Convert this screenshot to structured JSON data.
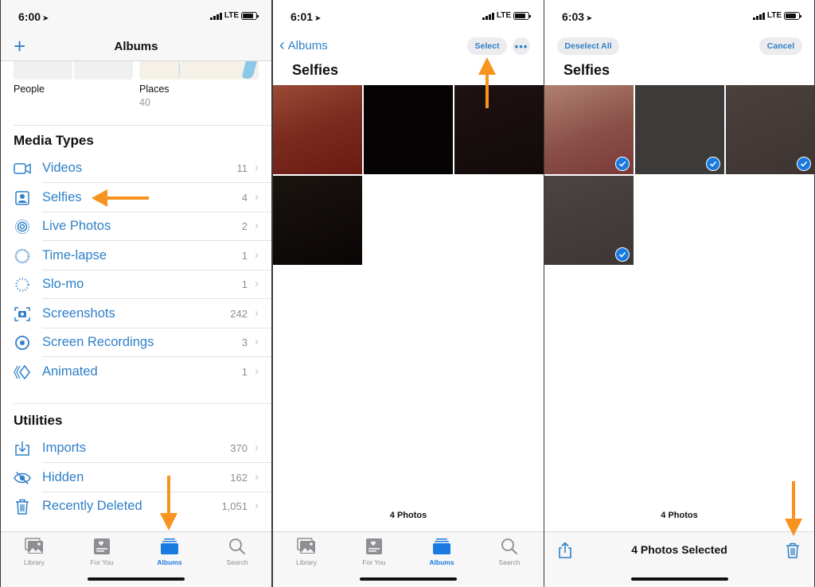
{
  "colors": {
    "accent": "#2f80c8",
    "tint_active": "#1a7ae0",
    "annotation_arrow": "#f7931e"
  },
  "status_icons": {
    "signal": "signal-bars-icon",
    "network": "LTE",
    "battery": "battery-icon",
    "location": "location-arrow-icon"
  },
  "panel1": {
    "time": "6:00",
    "nav": {
      "add_icon": "plus-icon",
      "title": "Albums"
    },
    "albums": [
      {
        "label": "People",
        "count": ""
      },
      {
        "label": "Places",
        "count": "40"
      }
    ],
    "media_types": {
      "title": "Media Types",
      "items": [
        {
          "icon": "video-camera-icon",
          "label": "Videos",
          "count": "11"
        },
        {
          "icon": "selfie-portrait-icon",
          "label": "Selfies",
          "count": "4"
        },
        {
          "icon": "live-photo-icon",
          "label": "Live Photos",
          "count": "2"
        },
        {
          "icon": "timelapse-icon",
          "label": "Time-lapse",
          "count": "1"
        },
        {
          "icon": "slomo-icon",
          "label": "Slo-mo",
          "count": "1"
        },
        {
          "icon": "screenshot-icon",
          "label": "Screenshots",
          "count": "242"
        },
        {
          "icon": "screen-recording-icon",
          "label": "Screen Recordings",
          "count": "3"
        },
        {
          "icon": "animated-icon",
          "label": "Animated",
          "count": "1"
        }
      ]
    },
    "utilities": {
      "title": "Utilities",
      "items": [
        {
          "icon": "import-icon",
          "label": "Imports",
          "count": "370"
        },
        {
          "icon": "hidden-eye-icon",
          "label": "Hidden",
          "count": "162"
        },
        {
          "icon": "trash-icon",
          "label": "Recently Deleted",
          "count": "1,051"
        }
      ]
    },
    "tabs": [
      {
        "label": "Library",
        "icon": "library-icon",
        "active": false
      },
      {
        "label": "For You",
        "icon": "for-you-icon",
        "active": false
      },
      {
        "label": "Albums",
        "icon": "albums-icon",
        "active": true
      },
      {
        "label": "Search",
        "icon": "search-icon",
        "active": false
      }
    ]
  },
  "panel2": {
    "time": "6:01",
    "back_label": "Albums",
    "select_label": "Select",
    "more_icon": "ellipsis-icon",
    "title": "Selfies",
    "photos": [
      {
        "color": "reddish-brown"
      },
      {
        "color": "black"
      },
      {
        "color": "dark-brown"
      },
      {
        "color": "dark"
      }
    ],
    "photo_count": "4 Photos",
    "tabs": [
      {
        "label": "Library",
        "active": false
      },
      {
        "label": "For You",
        "active": false
      },
      {
        "label": "Albums",
        "active": true
      },
      {
        "label": "Search",
        "active": false
      }
    ]
  },
  "panel3": {
    "time": "6:03",
    "deselect_label": "Deselect All",
    "cancel_label": "Cancel",
    "title": "Selfies",
    "photos": [
      {
        "selected": true
      },
      {
        "selected": true
      },
      {
        "selected": true
      },
      {
        "selected": true
      }
    ],
    "photo_count": "4 Photos",
    "selection_text": "4 Photos Selected",
    "share_icon": "share-icon",
    "delete_icon": "trash-icon"
  }
}
